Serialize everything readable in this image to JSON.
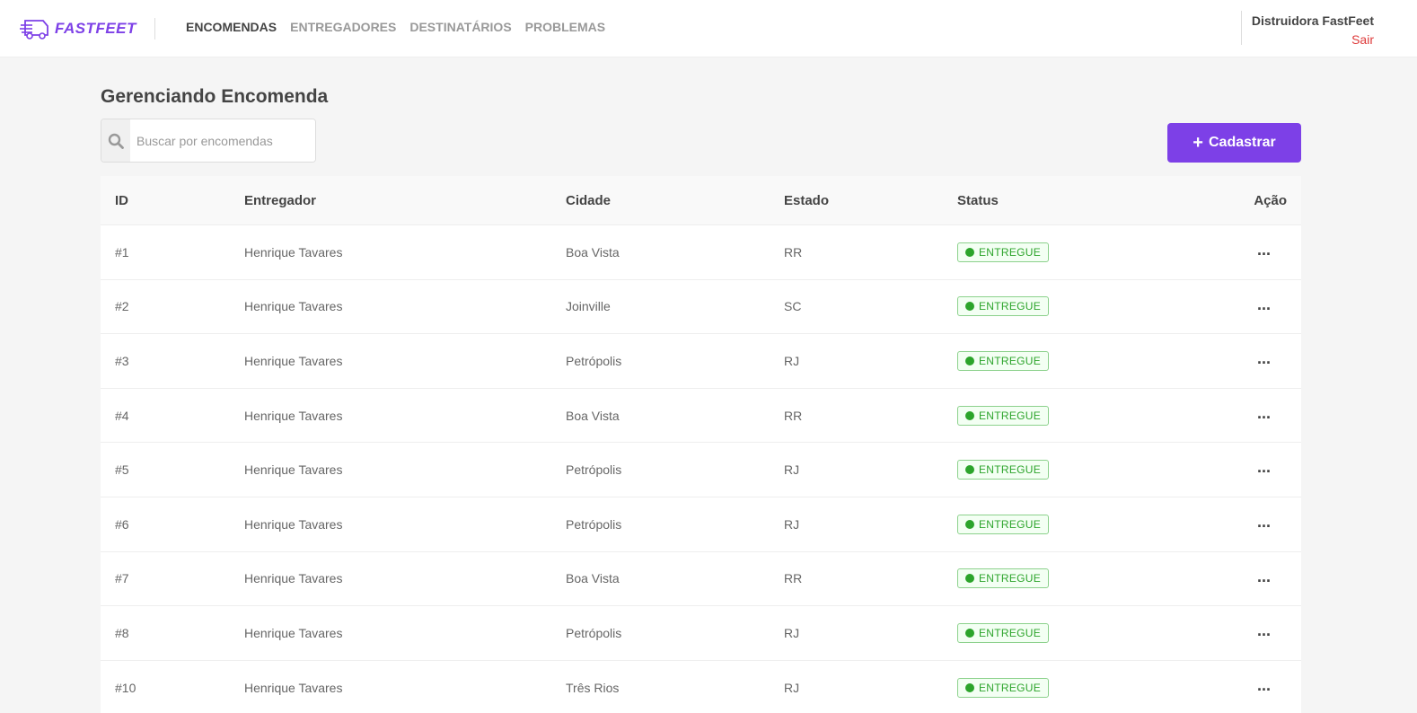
{
  "brand": {
    "name": "FASTFEET",
    "accent": "#7d40e7"
  },
  "nav": {
    "items": [
      {
        "label": "ENCOMENDAS",
        "active": true
      },
      {
        "label": "ENTREGADORES",
        "active": false
      },
      {
        "label": "DESTINATÁRIOS",
        "active": false
      },
      {
        "label": "PROBLEMAS",
        "active": false
      }
    ]
  },
  "user": {
    "name": "Distruidora FastFeet",
    "logout": "Sair"
  },
  "page": {
    "title": "Gerenciando Encomenda"
  },
  "search": {
    "placeholder": "Buscar por encomendas",
    "value": ""
  },
  "actions": {
    "add_label": "Cadastrar"
  },
  "table": {
    "headers": {
      "id": "ID",
      "deliveryman": "Entregador",
      "city": "Cidade",
      "state": "Estado",
      "status": "Status",
      "action": "Ação"
    },
    "rows": [
      {
        "id": "#1",
        "deliveryman": "Henrique Tavares",
        "city": "Boa Vista",
        "state": "RR",
        "status": "ENTREGUE"
      },
      {
        "id": "#2",
        "deliveryman": "Henrique Tavares",
        "city": "Joinville",
        "state": "SC",
        "status": "ENTREGUE"
      },
      {
        "id": "#3",
        "deliveryman": "Henrique Tavares",
        "city": "Petrópolis",
        "state": "RJ",
        "status": "ENTREGUE"
      },
      {
        "id": "#4",
        "deliveryman": "Henrique Tavares",
        "city": "Boa Vista",
        "state": "RR",
        "status": "ENTREGUE"
      },
      {
        "id": "#5",
        "deliveryman": "Henrique Tavares",
        "city": "Petrópolis",
        "state": "RJ",
        "status": "ENTREGUE"
      },
      {
        "id": "#6",
        "deliveryman": "Henrique Tavares",
        "city": "Petrópolis",
        "state": "RJ",
        "status": "ENTREGUE"
      },
      {
        "id": "#7",
        "deliveryman": "Henrique Tavares",
        "city": "Boa Vista",
        "state": "RR",
        "status": "ENTREGUE"
      },
      {
        "id": "#8",
        "deliveryman": "Henrique Tavares",
        "city": "Petrópolis",
        "state": "RJ",
        "status": "ENTREGUE"
      },
      {
        "id": "#10",
        "deliveryman": "Henrique Tavares",
        "city": "Três Rios",
        "state": "RJ",
        "status": "ENTREGUE"
      }
    ]
  },
  "colors": {
    "status_delivered": "#2ca42b",
    "logout": "#de3b3b"
  }
}
